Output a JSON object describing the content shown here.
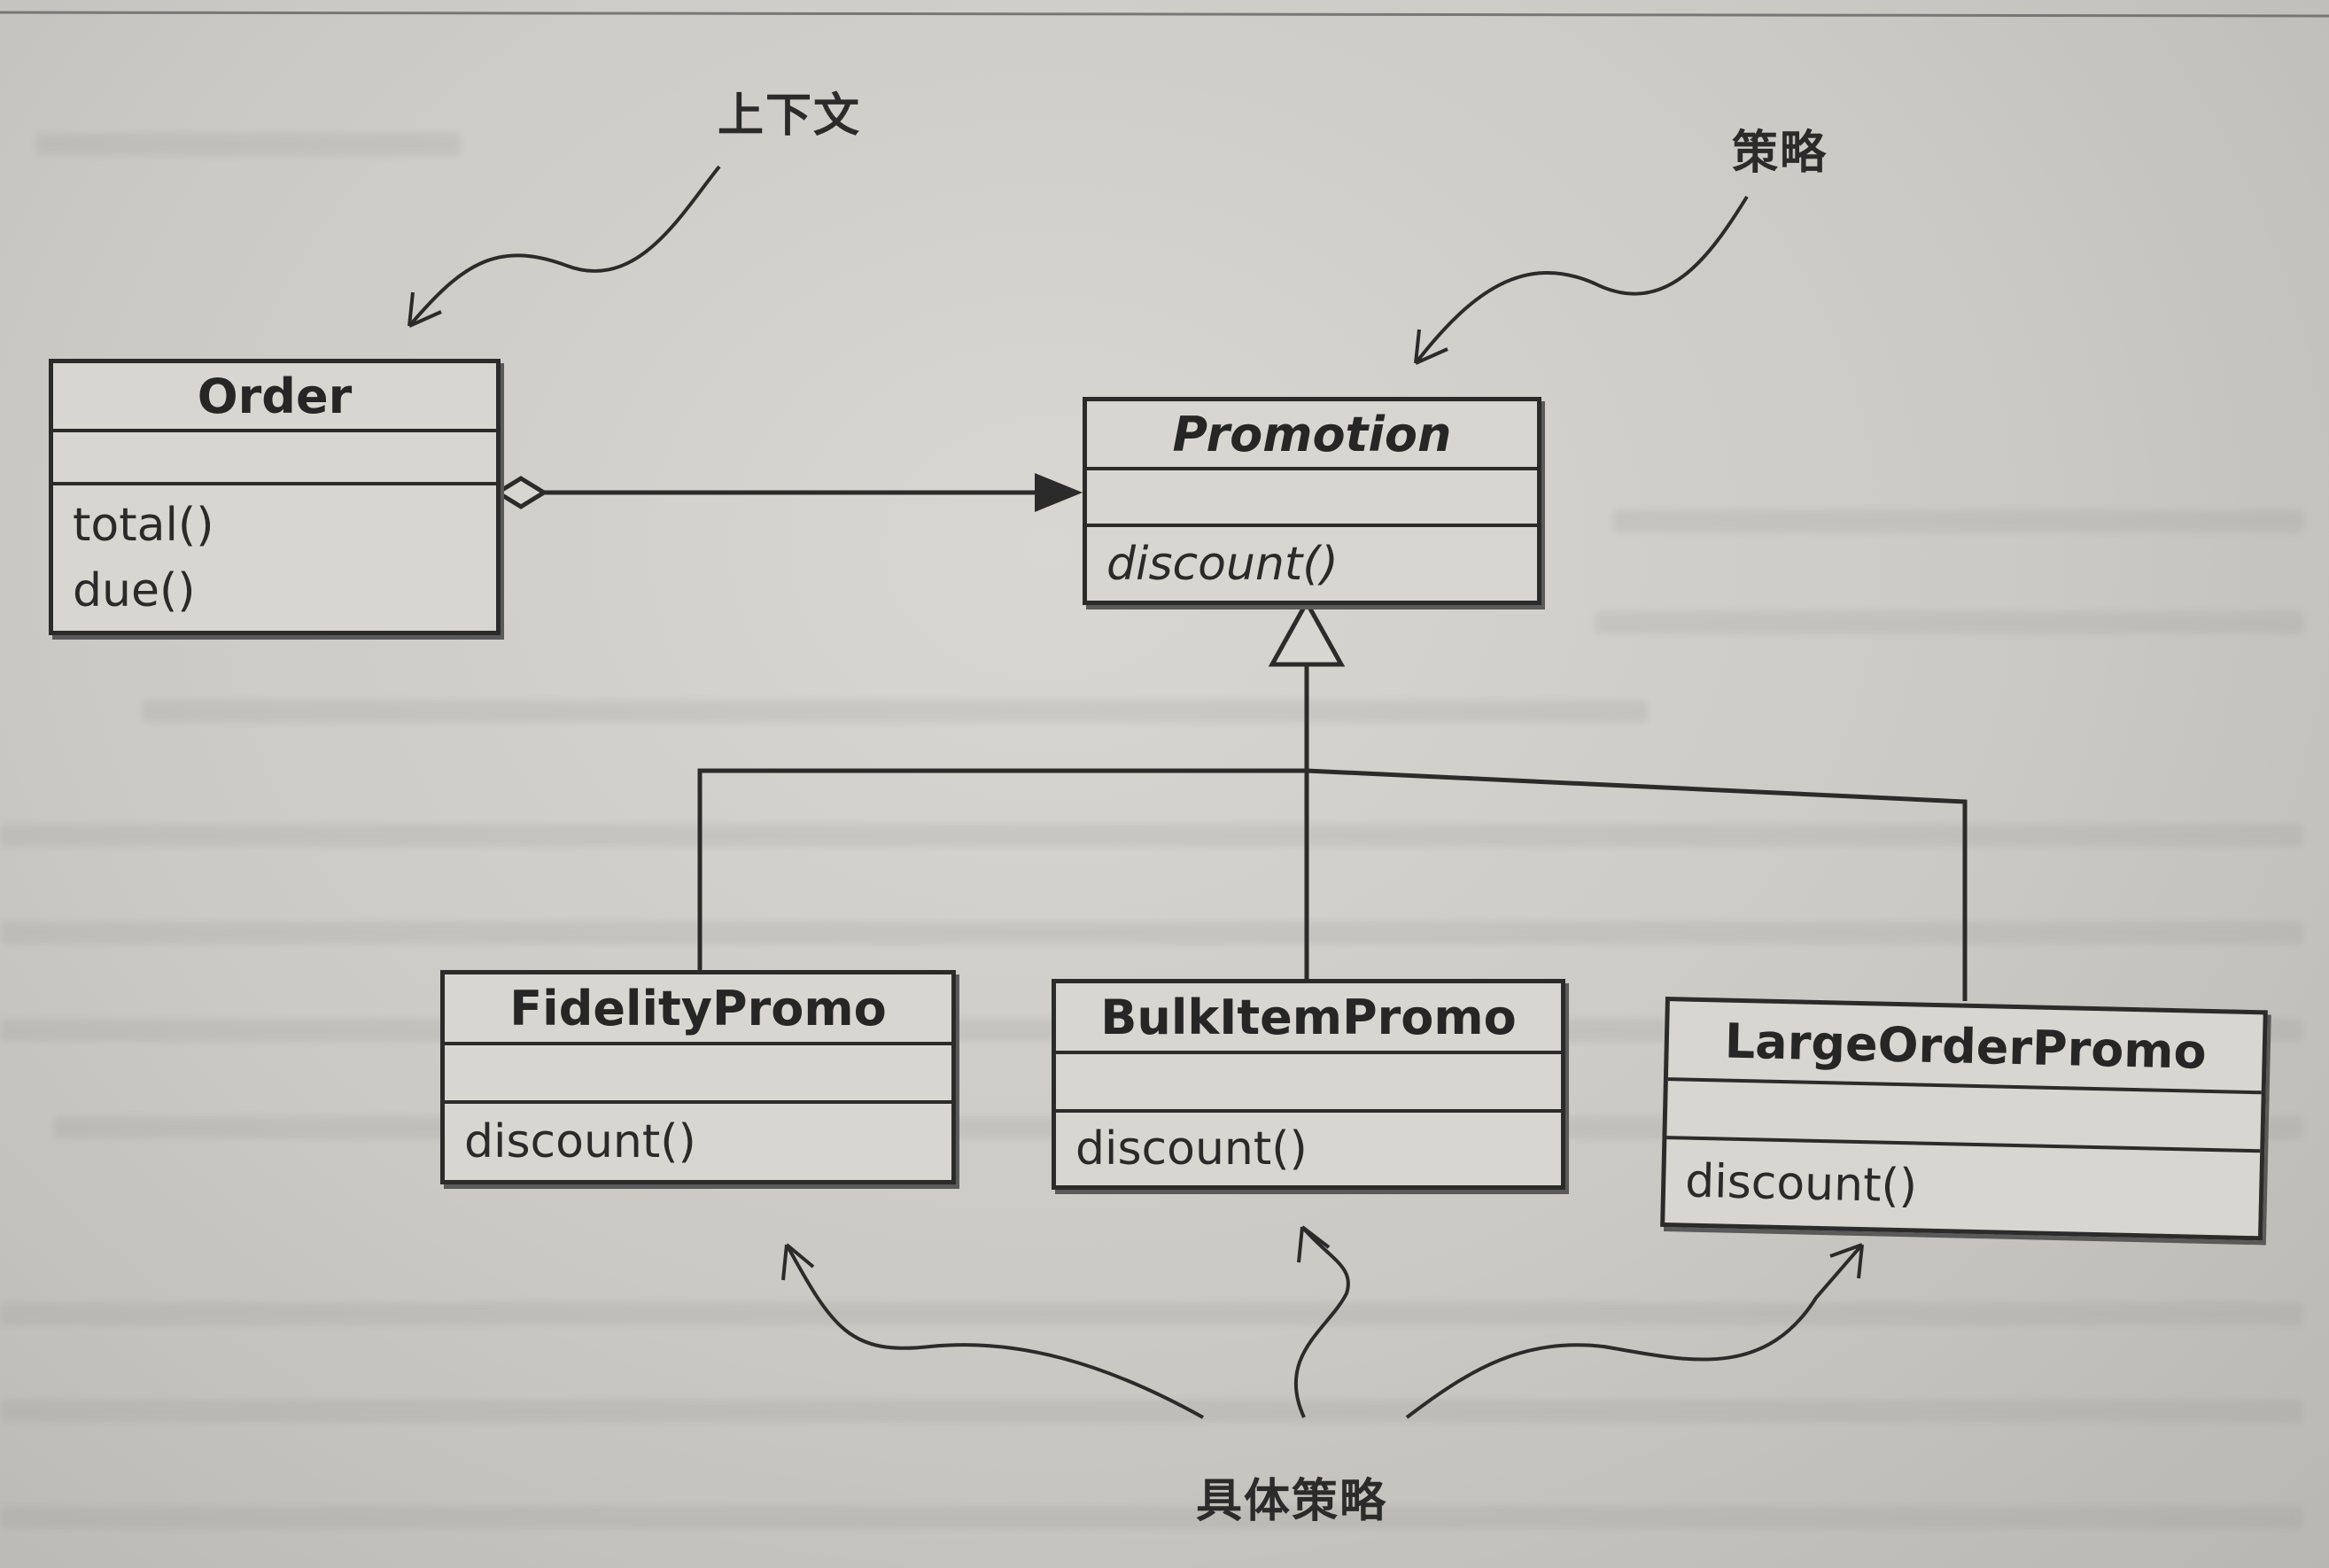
{
  "labels": {
    "context": "上下文",
    "strategy": "策略",
    "concrete": "具体策略"
  },
  "classes": {
    "order": {
      "name": "Order",
      "ops": [
        "total()",
        "due()"
      ]
    },
    "promotion": {
      "name": "Promotion",
      "ops": [
        "discount()"
      ]
    },
    "fidelity": {
      "name": "FidelityPromo",
      "ops": [
        "discount()"
      ]
    },
    "bulk": {
      "name": "BulkItemPromo",
      "ops": [
        "discount()"
      ]
    },
    "large": {
      "name": "LargeOrderPromo",
      "ops": [
        "discount()"
      ]
    }
  },
  "colors": {
    "ink": "#2b2b2b",
    "paper": "#d8d6d1"
  }
}
